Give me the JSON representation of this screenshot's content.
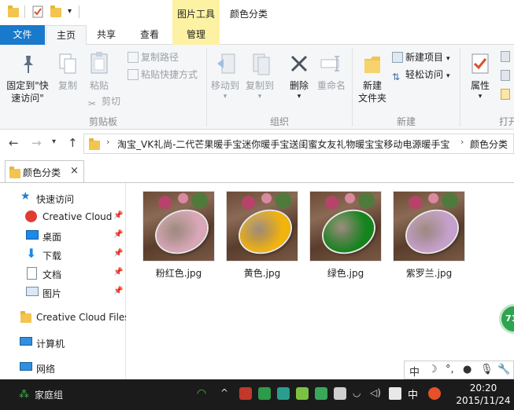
{
  "titlebar": {
    "context_tab_label": "图片工具",
    "window_title": "颜色分类"
  },
  "tabs": {
    "file": "文件",
    "home": "主页",
    "share": "共享",
    "view": "查看",
    "manage": "管理"
  },
  "ribbon": {
    "pin_quick_access_line1": "固定到\"快",
    "pin_quick_access_line2": "速访问\"",
    "copy": "复制",
    "paste": "粘贴",
    "copy_path": "复制路径",
    "paste_shortcut": "粘贴快捷方式",
    "cut": "剪切",
    "clipboard_group": "剪贴板",
    "move_to": "移动到",
    "copy_to": "复制到",
    "delete": "删除",
    "rename": "重命名",
    "organize_group": "组织",
    "new_folder_line1": "新建",
    "new_folder_line2": "文件夹",
    "new_item": "新建项目",
    "easy_access": "轻松访问",
    "new_group": "新建",
    "properties": "属性",
    "open_group": "打开"
  },
  "address": {
    "path_segment_1": "淘宝_VK礼尚-二代芒果暖手宝迷你暖手宝送闺蜜女友礼物暖宝宝移动电源暖手宝",
    "path_segment_2": "颜色分类"
  },
  "doc_tab": {
    "label": "颜色分类",
    "close": "×"
  },
  "navpane": {
    "quick_access": "快速访问",
    "creative_cloud": "Creative Cloud",
    "desktop": "桌面",
    "downloads": "下载",
    "documents": "文档",
    "pictures": "图片",
    "cc_files": "Creative Cloud Files",
    "this_pc": "计算机",
    "network": "网络",
    "homegroup": "家庭组"
  },
  "files": [
    {
      "name": "粉红色.jpg",
      "color": "#d9a7b7"
    },
    {
      "name": "黄色.jpg",
      "color": "#f2b30d"
    },
    {
      "name": "绿色.jpg",
      "color": "#14841c"
    },
    {
      "name": "紫罗兰.jpg",
      "color": "#c6a0cd"
    }
  ],
  "ime": {
    "mode": "中"
  },
  "badge": {
    "text": "71"
  },
  "taskbar": {
    "ime_label": "中",
    "time": "20:20",
    "date": "2015/11/24"
  },
  "colors": {
    "file_tab": "#1979ca",
    "context_tab": "#fdf2a3",
    "taskbar": "#1b1b1b"
  }
}
